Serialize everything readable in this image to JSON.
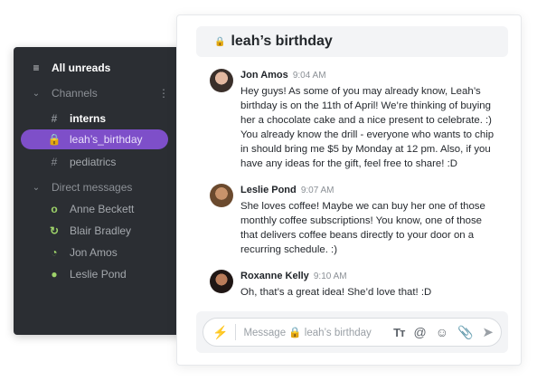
{
  "sidebar": {
    "all_unreads": "All unreads",
    "channels_label": "Channels",
    "channels_more": "⋮",
    "channels": [
      {
        "icon": "#",
        "name": "interns"
      },
      {
        "icon": "🔒",
        "name": "leah’s_birthday"
      },
      {
        "icon": "#",
        "name": "pediatrics"
      }
    ],
    "dm_label": "Direct messages",
    "dms": [
      {
        "icon": "o",
        "name": "Anne Beckett"
      },
      {
        "icon": "↻",
        "name": "Blair Bradley"
      },
      {
        "icon": "◔",
        "name": "Jon Amos"
      },
      {
        "icon": "●",
        "name": "Leslie Pond"
      }
    ]
  },
  "channel": {
    "title": "leah’s birthday"
  },
  "messages": [
    {
      "name": "Jon Amos",
      "time": "9:04 AM",
      "text": "Hey guys! As some of you may already know, Leah’s\nbirthday is on the 11th of April! We’re thinking of buying\nher a chocolate cake and a nice present to celebrate. :)\nYou already know the drill - everyone who wants to chip\nin should bring me $5 by Monday at 12 pm. Also, if you\nhave any ideas for the gift, feel free to share! :D"
    },
    {
      "name": "Leslie Pond",
      "time": "9:07 AM",
      "text": "She loves coffee! Maybe we can buy her one of those\nmonthly coffee subscriptions! You know, one of those\nthat delivers coffee beans directly to your door on a\nrecurring schedule. :)"
    },
    {
      "name": "Roxanne Kelly",
      "time": "9:10 AM",
      "text": "Oh, that’s a great idea! She’d love that! :D"
    }
  ],
  "composer": {
    "placeholder": "Message 🔒 leah’s birthday"
  }
}
